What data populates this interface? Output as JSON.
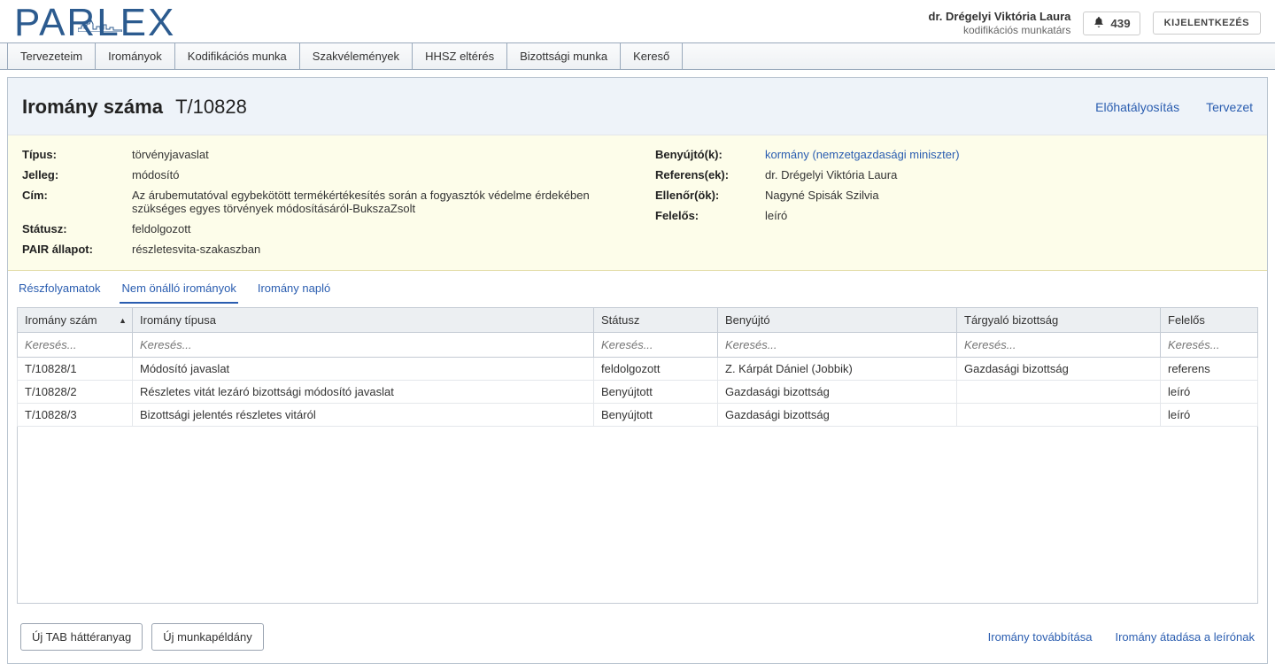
{
  "user": {
    "name": "dr. Drégelyi Viktória Laura",
    "role": "kodifikációs munkatárs",
    "notification_count": "439",
    "logout_label": "KIJELENTKEZÉS"
  },
  "nav": [
    "Tervezeteim",
    "Irományok",
    "Kodifikációs munka",
    "Szakvélemények",
    "HHSZ eltérés",
    "Bizottsági munka",
    "Kereső"
  ],
  "page": {
    "title_label": "Iromány száma",
    "doc_number": "T/10828",
    "link_prevalidate": "Előhatályosítás",
    "link_draft": "Tervezet"
  },
  "summary_left": {
    "tipus_k": "Típus:",
    "tipus_v": "törvényjavaslat",
    "jelleg_k": "Jelleg:",
    "jelleg_v": "módosító",
    "cim_k": "Cím:",
    "cim_v": "Az árubemutatóval egybekötött termékértékesítés során a fogyasztók védelme érdekében szükséges egyes törvények módosításáról-BukszaZsolt",
    "stat_k": "Státusz:",
    "stat_v": "feldolgozott",
    "pair_k": "PAIR állapot:",
    "pair_v": "részletesvita-szakaszban"
  },
  "summary_right": {
    "beny_k": "Benyújtó(k):",
    "beny_v": "kormány (nemzetgazdasági miniszter)",
    "ref_k": "Referens(ek):",
    "ref_v": "dr. Drégelyi Viktória Laura",
    "ell_k": "Ellenőr(ök):",
    "ell_v": "Nagyné Spisák Szilvia",
    "fel_k": "Felelős:",
    "fel_v": "leíró"
  },
  "sub_tabs": {
    "reszfolyamatok": "Részfolyamatok",
    "nem_onallo": "Nem önálló irományok",
    "naplo": "Iromány napló"
  },
  "table": {
    "headers": {
      "num": "Iromány szám",
      "type": "Iromány típusa",
      "status": "Státusz",
      "submitter": "Benyújtó",
      "committee": "Tárgyaló bizottság",
      "responsible": "Felelős"
    },
    "filter_placeholder": "Keresés...",
    "rows": [
      {
        "num": "T/10828/1",
        "type": "Módosító javaslat",
        "status": "feldolgozott",
        "submitter": "Z. Kárpát Dániel (Jobbik)",
        "committee": "Gazdasági bizottság",
        "responsible": "referens"
      },
      {
        "num": "T/10828/2",
        "type": "Részletes vitát lezáró bizottsági módosító javaslat",
        "status": "Benyújtott",
        "submitter": "Gazdasági bizottság",
        "committee": "",
        "responsible": "leíró"
      },
      {
        "num": "T/10828/3",
        "type": "Bizottsági jelentés részletes vitáról",
        "status": "Benyújtott",
        "submitter": "Gazdasági bizottság",
        "committee": "",
        "responsible": "leíró"
      }
    ]
  },
  "footer": {
    "btn_new_tab": "Új TAB háttéranyag",
    "btn_new_work": "Új munkapéldány",
    "link_forward": "Iromány továbbítása",
    "link_handover": "Iromány átadása a leírónak"
  }
}
